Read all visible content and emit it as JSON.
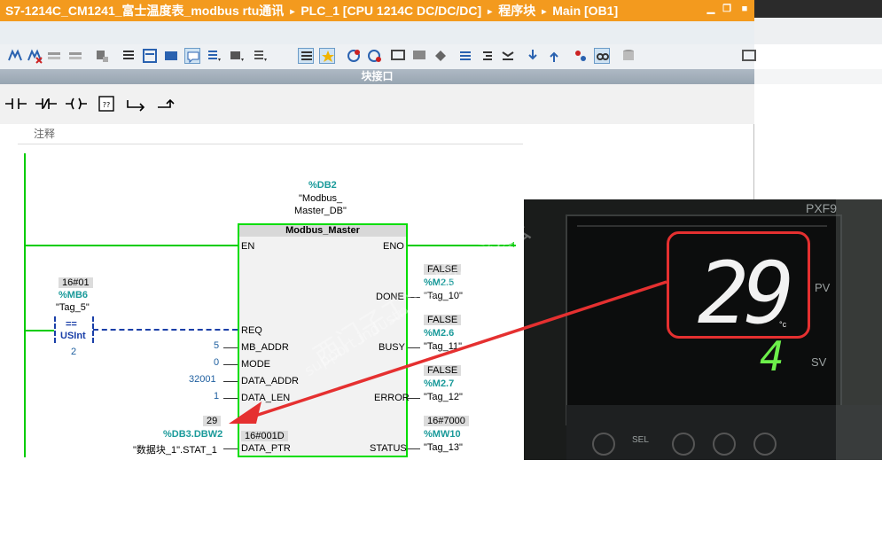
{
  "title": {
    "project": "S7-1214C_CM1241_富士温度表_modbus rtu通讯",
    "device": "PLC_1 [CPU 1214C DC/DC/DC]",
    "folder": "程序块",
    "block": "Main [OB1]",
    "sep": "▸"
  },
  "window_controls": {
    "minimize": "▁",
    "restore": "❐",
    "close": "■"
  },
  "interface_bar": "块接口",
  "comment_label": "注释",
  "instance_db": {
    "address": "%DB2",
    "name_line1": "\"Modbus_",
    "name_line2": "Master_DB\""
  },
  "block": {
    "title": "Modbus_Master",
    "inputs": [
      {
        "pin": "EN"
      },
      {
        "pin": "REQ"
      },
      {
        "pin": "MB_ADDR",
        "value": "5"
      },
      {
        "pin": "MODE",
        "value": "0"
      },
      {
        "pin": "DATA_ADDR",
        "value": "32001"
      },
      {
        "pin": "DATA_LEN",
        "value": "1"
      },
      {
        "pin": "DATA_PTR",
        "inner_value": "16#001D"
      }
    ],
    "outputs": [
      {
        "pin": "ENO"
      },
      {
        "pin": "DONE",
        "status": "FALSE",
        "address": "%M2.5",
        "tag": "\"Tag_10\""
      },
      {
        "pin": "BUSY",
        "status": "FALSE",
        "address": "%M2.6",
        "tag": "\"Tag_11\""
      },
      {
        "pin": "ERROR",
        "status": "FALSE",
        "address": "%M2.7",
        "tag": "\"Tag_12\""
      },
      {
        "pin": "STATUS",
        "status": "16#7000",
        "address": "%MW10",
        "tag": "\"Tag_13\""
      }
    ]
  },
  "compare": {
    "value": "16#01",
    "address": "%MB6",
    "tag": "\"Tag_5\"",
    "op": "==",
    "type": "USInt",
    "operand": "2"
  },
  "data_ptr_operand": {
    "value": "29",
    "address": "%DB3.DBW2",
    "tag": "\"数据块_1\".STAT_1"
  },
  "photo": {
    "reading": "29",
    "unit": "°c",
    "sv": "4",
    "model": "PXF9",
    "pv_label": "PV",
    "sv_label": "SV",
    "button_sel": "SEL",
    "watermark_cn": "西门子工业  技术论坛",
    "watermark_en": "support.industry.siemens.com/cs"
  },
  "colors": {
    "titlebar": "#f39a1e",
    "rail": "#00cc00",
    "highlight": "#e53030",
    "tag_teal": "#1a9a9a"
  }
}
